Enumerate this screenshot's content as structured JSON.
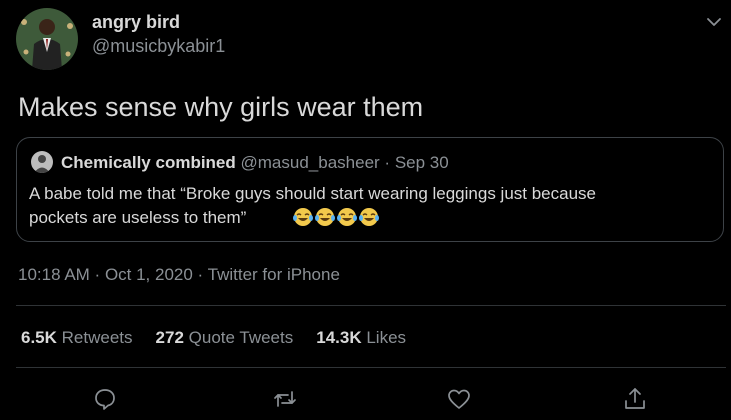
{
  "author": {
    "display_name": "angry bird",
    "handle": "@musicbykabir1"
  },
  "tweet": {
    "text": "Makes sense why girls wear them"
  },
  "quoted_tweet": {
    "display_name": "Chemically combined",
    "handle": "@masud_basheer",
    "separator": "·",
    "date": "Sep 30",
    "line1": "A babe  told me that “Broke guys should start wearing leggings just because",
    "line2": "pockets are useless to them”",
    "emojis": [
      "face-with-tears-of-joy",
      "face-with-tears-of-joy",
      "face-with-tears-of-joy",
      "face-with-tears-of-joy"
    ]
  },
  "meta": {
    "time": "10:18 AM",
    "sep1": " · ",
    "date": "Oct 1, 2020",
    "sep2": " · ",
    "source": "Twitter for iPhone"
  },
  "stats": {
    "retweets_count": "6.5K",
    "retweets_label": "Retweets",
    "quotes_count": "272",
    "quotes_label": "Quote Tweets",
    "likes_count": "14.3K",
    "likes_label": "Likes"
  },
  "actions": [
    "reply-icon",
    "retweet-icon",
    "like-icon",
    "share-icon"
  ],
  "colors": {
    "background": "#000000",
    "text": "#d9d9d9",
    "muted": "#8b9095",
    "border": "#3d4247"
  }
}
